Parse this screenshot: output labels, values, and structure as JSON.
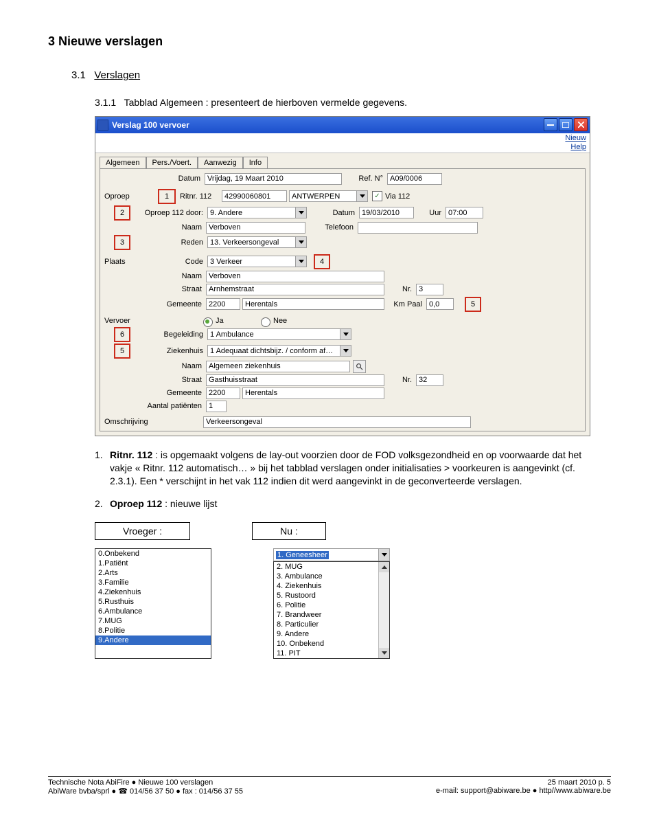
{
  "heading1": "3  Nieuwe verslagen",
  "heading2_num": "3.1",
  "heading2_text": "Verslagen",
  "body_intro_num": "3.1.1",
  "body_intro": "Tabblad Algemeen : presenteert de hierboven vermelde gegevens.",
  "window": {
    "title": "Verslag 100 vervoer",
    "menu_nieuw": "Nieuw",
    "menu_help": "Help",
    "tabs": {
      "t1": "Algemeen",
      "t2": "Pers./Voert.",
      "t3": "Aanwezig",
      "t4": "Info"
    },
    "datum_lbl": "Datum",
    "datum_val": "Vrijdag, 19 Maart 2010",
    "refn_lbl": "Ref. N°",
    "refn_val": "A09/0006",
    "sec_oproep": "Oproep",
    "ritnr_lbl": "Ritnr. 112",
    "ritnr_val": "42990060801",
    "ritnr_sel": "ANTWERPEN",
    "via112_lbl": "Via 112",
    "oproep112_lbl": "Oproep 112 door:",
    "oproep112_val": "9. Andere",
    "opr_datum_lbl": "Datum",
    "opr_datum_val": "19/03/2010",
    "opr_uur_lbl": "Uur",
    "opr_uur_val": "07:00",
    "opr_naam_lbl": "Naam",
    "opr_naam_val": "Verboven",
    "opr_tel_lbl": "Telefoon",
    "opr_tel_val": "",
    "reden_lbl": "Reden",
    "reden_val": "13. Verkeersongeval",
    "sec_plaats": "Plaats",
    "plaats_code_lbl": "Code",
    "plaats_code_val": "3 Verkeer",
    "plaats_naam_lbl": "Naam",
    "plaats_naam_val": "Verboven",
    "plaats_straat_lbl": "Straat",
    "plaats_straat_val": "Arnhemstraat",
    "plaats_nr_lbl": "Nr.",
    "plaats_nr_val": "3",
    "plaats_gem_lbl": "Gemeente",
    "plaats_gem_zip": "2200",
    "plaats_gem_val": "Herentals",
    "plaats_kmpaal_lbl": "Km Paal",
    "plaats_kmpaal_val": "0,0",
    "sec_vervoer": "Vervoer",
    "radio_ja": "Ja",
    "radio_nee": "Nee",
    "begeleiding_lbl": "Begeleiding",
    "begeleiding_val": "1 Ambulance",
    "ziekenhuis_lbl": "Ziekenhuis",
    "ziekenhuis_val": "1 Adequaat dichtsbijz. / conform af…",
    "verv_naam_lbl": "Naam",
    "verv_naam_val": "Algemeen ziekenhuis",
    "verv_straat_lbl": "Straat",
    "verv_straat_val": "Gasthuisstraat",
    "verv_nr_lbl": "Nr.",
    "verv_nr_val": "32",
    "verv_gem_lbl": "Gemeente",
    "verv_gem_zip": "2200",
    "verv_gem_val": "Herentals",
    "aantal_pat_lbl": "Aantal patiënten",
    "aantal_pat_val": "1",
    "sec_omschrijving": "Omschrijving",
    "omschrijving_val": "Verkeersongeval",
    "callouts": {
      "c1": "1",
      "c2": "2",
      "c3": "3",
      "c4": "4",
      "c5": "5",
      "c6": "6",
      "c5b": "5"
    }
  },
  "body_after": {
    "n1": "1.",
    "t1a": "Ritnr. 112",
    "t1b": " : is opgemaakt volgens de lay-out voorzien door de FOD volksgezondheid en op voorwaarde dat het vakje « Ritnr. 112 automatisch… » bij het tabblad verslagen onder initialisaties > voorkeuren is aangevinkt (cf. 2.3.1). Een * verschijnt in het vak 112 indien dit werd aangevinkt in de geconverteerde verslagen.",
    "n2": "2.",
    "t2a": "Oproep 112",
    "t2b": " : nieuwe lijst"
  },
  "boxes": {
    "vroeger": "Vroeger :",
    "nu": "Nu :"
  },
  "list_vroeger": {
    "i0": "0.Onbekend",
    "i1": "1.Patiënt",
    "i2": "2.Arts",
    "i3": "3.Familie",
    "i4": "4.Ziekenhuis",
    "i5": "5.Rusthuis",
    "i6": "6.Ambulance",
    "i7": "7.MUG",
    "i8": "8.Politie",
    "i9": "9.Andere"
  },
  "list_nu": {
    "sel": "1. Geneesheer",
    "i2": "2. MUG",
    "i3": "3. Ambulance",
    "i4": "4. Ziekenhuis",
    "i5": "5. Rustoord",
    "i6": "6. Politie",
    "i7": "7. Brandweer",
    "i8": "8. Particulier",
    "i9": "9. Andere",
    "i10": "10. Onbekend",
    "i11": "11. PIT"
  },
  "footer": {
    "l1": "Technische Nota AbiFire ● Nieuwe 100 verslagen",
    "l2a": "AbiWare bvba/sprl ● ",
    "l2b": " 014/56 37 50 ● fax : 014/56 37 55",
    "r1": "25 maart 2010 p. 5",
    "r2": "e-mail: support@abiware.be ● http//www.abiware.be"
  }
}
